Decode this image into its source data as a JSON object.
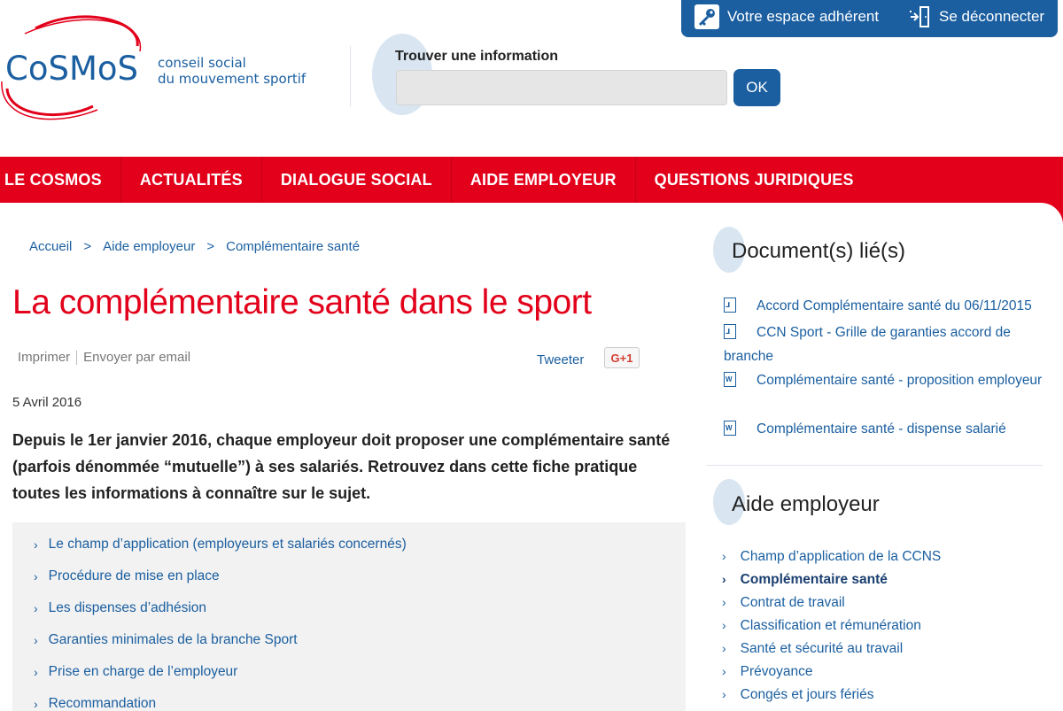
{
  "userbar": {
    "member_label": "Votre espace adhérent",
    "logout_label": "Se déconnecter",
    "bg_color": "#1b5fa0"
  },
  "logo": {
    "word": "CoSMoS",
    "tagline_1": "conseil social",
    "tagline_2": "du mouvement sportif"
  },
  "search": {
    "title": "Trouver une information",
    "placeholder": "",
    "button_label": "OK"
  },
  "nav": {
    "items": [
      {
        "label": "LE COSMOS"
      },
      {
        "label": "ACTUALITÉS"
      },
      {
        "label": "DIALOGUE SOCIAL"
      },
      {
        "label": "AIDE EMPLOYEUR"
      },
      {
        "label": "QUESTIONS JURIDIQUES"
      }
    ],
    "color": "#e2001a"
  },
  "breadcrumb": {
    "items": [
      "Accueil",
      "Aide employeur",
      "Complémentaire santé"
    ],
    "separator": ">"
  },
  "article": {
    "title": "La complémentaire santé dans le sport",
    "print_label": "Imprimer",
    "email_label": "Envoyer par email",
    "tweet_label": "Tweeter",
    "gplus_label": "G+1",
    "date": "5 Avril 2016",
    "intro": "Depuis le 1er janvier 2016, chaque employeur doit proposer une complémentaire santé (parfois dénommée “mutuelle”) à ses salariés. Retrouvez dans cette fiche pratique toutes les informations à connaître sur le sujet.",
    "toc": [
      "Le champ d’application (employeurs et salariés concernés)",
      "Procédure de mise en place",
      "Les dispenses d’adhésion",
      "Garanties minimales de la branche Sport",
      "Prise en charge de l’employeur",
      "Recommandation"
    ]
  },
  "sidebar": {
    "docs_title": "Document(s) lié(s)",
    "docs": [
      {
        "label": "Accord Complémentaire santé du 06/11/2015",
        "icon": "pdf-icon"
      },
      {
        "label": "CCN Sport - Grille de garanties accord de branche",
        "icon": "pdf-icon"
      },
      {
        "label": "Complémentaire santé - proposition employeur",
        "icon": "word-icon"
      },
      {
        "label": "Complémentaire santé - dispense salarié",
        "icon": "word-icon"
      }
    ],
    "aide_title": "Aide employeur",
    "aide_links": [
      {
        "label": "Champ d’application de la CCNS",
        "active": false
      },
      {
        "label": "Complémentaire santé",
        "active": true
      },
      {
        "label": "Contrat de travail",
        "active": false
      },
      {
        "label": "Classification et rémunération",
        "active": false
      },
      {
        "label": "Santé et sécurité au travail",
        "active": false
      },
      {
        "label": "Prévoyance",
        "active": false
      },
      {
        "label": "Congés et jours fériés",
        "active": false
      }
    ]
  }
}
